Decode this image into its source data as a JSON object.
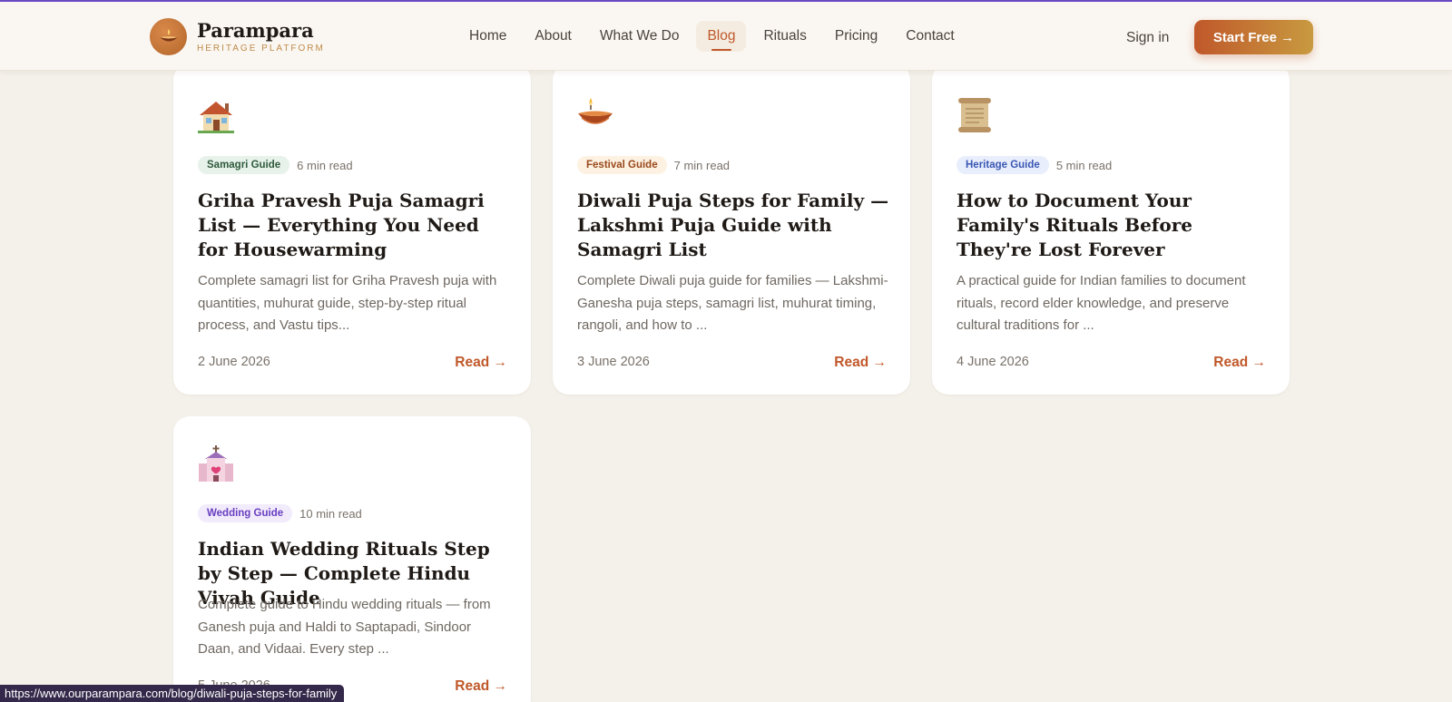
{
  "header": {
    "logo_name": "Parampara",
    "logo_sub": "HERITAGE PLATFORM",
    "nav": [
      {
        "label": "Home"
      },
      {
        "label": "About"
      },
      {
        "label": "What We Do"
      },
      {
        "label": "Blog",
        "active": true
      },
      {
        "label": "Rituals"
      },
      {
        "label": "Pricing"
      },
      {
        "label": "Contact"
      }
    ],
    "sign_in": "Sign in",
    "cta": "Start Free →"
  },
  "cards": [
    {
      "icon": "house-icon",
      "tag": "Samagri Guide",
      "read_time": "6 min read",
      "title": "Griha Pravesh Puja Samagri List — Everything You Need for Housewarming",
      "excerpt": "Complete samagri list for Griha Pravesh puja with quantities, muhurat guide, step-by-step ritual process, and Vastu tips...",
      "date": "2 June 2026",
      "read_label": "Read →"
    },
    {
      "icon": "diya-lamp-icon",
      "tag": "Festival Guide",
      "read_time": "7 min read",
      "title": "Diwali Puja Steps for Family — Lakshmi Puja Guide with Samagri List",
      "excerpt": "Complete Diwali puja guide for families — Lakshmi-Ganesha puja steps, samagri list, muhurat timing, rangoli, and how to ...",
      "date": "3 June 2026",
      "read_label": "Read →"
    },
    {
      "icon": "scroll-icon",
      "tag": "Heritage Guide",
      "read_time": "5 min read",
      "title": "How to Document Your Family's Rituals Before They're Lost Forever",
      "excerpt": "A practical guide for Indian families to document rituals, record elder knowledge, and preserve cultural traditions for ...",
      "date": "4 June 2026",
      "read_label": "Read →"
    },
    {
      "icon": "wedding-chapel-icon",
      "tag": "Wedding Guide",
      "read_time": "10 min read",
      "title": "Indian Wedding Rituals Step by Step — Complete Hindu Vivah Guide",
      "excerpt": "Complete guide to Hindu wedding rituals — from Ganesh puja and Haldi to Saptapadi, Sindoor Daan, and Vidaai. Every step ...",
      "date": "5 June 2026",
      "read_label": "Read →"
    }
  ],
  "status_url": "https://www.ourparampara.com/blog/diwali-puja-steps-for-family",
  "colors": {
    "accent": "#c0582a",
    "tag_samagri_bg": "#e6f2ea",
    "tag_samagri_fg": "#2f5a3c",
    "tag_festival_bg": "#fdf1e2",
    "tag_festival_fg": "#9a4a1c",
    "tag_heritage_bg": "#e8eefb",
    "tag_heritage_fg": "#3a57b4",
    "tag_wedding_bg": "#f1ebfb",
    "tag_wedding_fg": "#6a3fc2"
  }
}
